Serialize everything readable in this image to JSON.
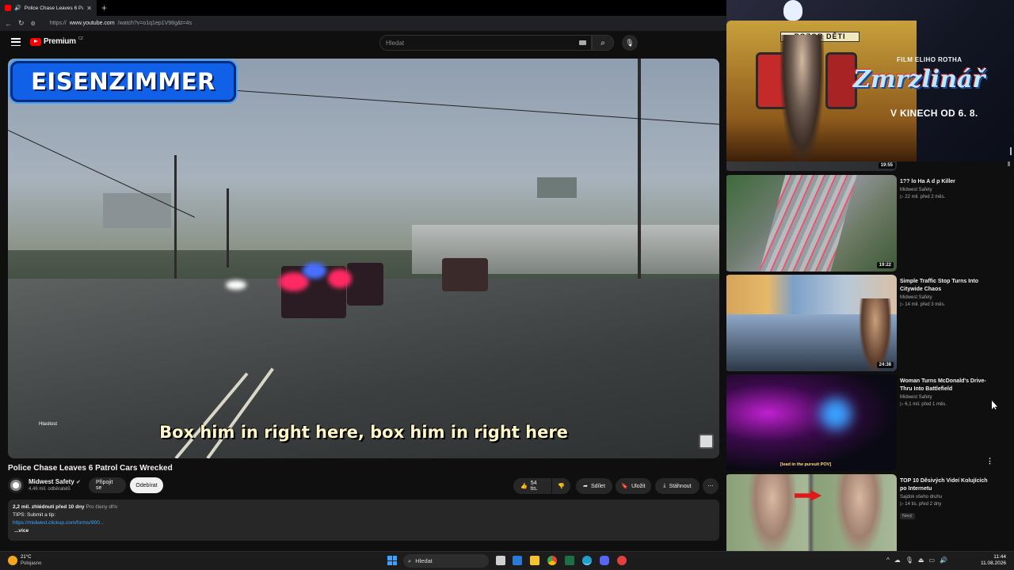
{
  "browser": {
    "tab_title": "Police Chase Leaves 6 Patrol C...",
    "url_prefix": "https://",
    "url_domain": "www.youtube.com",
    "url_path": "/watch?v=o1q1ep1V98g&t=4s"
  },
  "header": {
    "logo_text": "Premium",
    "logo_sup": "CZ",
    "search_placeholder": "Hledat"
  },
  "player": {
    "brand_overlay": "EISENZIMMER",
    "caption": "Box him in right here, box him in right here",
    "volume_label": "Hlasitost"
  },
  "video": {
    "title": "Police Chase Leaves 6 Patrol Cars Wrecked",
    "channel": "Midwest Safety",
    "subscribers": "4,46 mil. odběratelů",
    "join_label": "Připojit se",
    "subscribe_label": "Odebírat",
    "likes": "54 tis.",
    "share_label": "Sdílet",
    "save_label": "Uložit",
    "download_label": "Stáhnout"
  },
  "description": {
    "views_date": "2,2 mil. zhlédnutí  před 10 dny",
    "members": "Pro členy dřív",
    "line1": "TIPS: Submit a tip:",
    "link": "https://midwest.clickup.com/forms/900...",
    "more": "...více"
  },
  "ad": {
    "sign": "POZOR DĚTI",
    "film_by": "FILM ELIHO ROTHA",
    "logo": "Zmrzlinář",
    "date": "V KINECH OD 6. 8."
  },
  "recommendations": [
    {
      "title": "1?? lo  Ha     A    d   p Killer",
      "channel": "Midwest Safety",
      "meta": "▷ 22 mil.  před 2 měs.",
      "duration": "19:22",
      "prev_duration": "19:55"
    },
    {
      "title": "Simple Traffic Stop Turns Into Citywide Chaos",
      "channel": "Midwest Safety",
      "meta": "▷ 14 mil.  před 3 měs.",
      "duration": "24:38"
    },
    {
      "title": "Woman Turns McDonald's Drive-Thru Into Battlefield",
      "channel": "Midwest Safety",
      "meta": "▷ 6,1 mil.  před 1 měs.",
      "overlay": "[lead in the pursuit POV]"
    },
    {
      "title": "TOP 10 Děsivých Videí Kolujících po Internetu",
      "channel": "Sajdok všeho druhu",
      "meta": "▷ 14 tis.  před 2 dny",
      "badge": "Nový"
    }
  ],
  "taskbar": {
    "temp": "21°C",
    "condition": "Polojasno",
    "search": "Hledat",
    "time": "11:44",
    "date": "11.08.2026"
  }
}
